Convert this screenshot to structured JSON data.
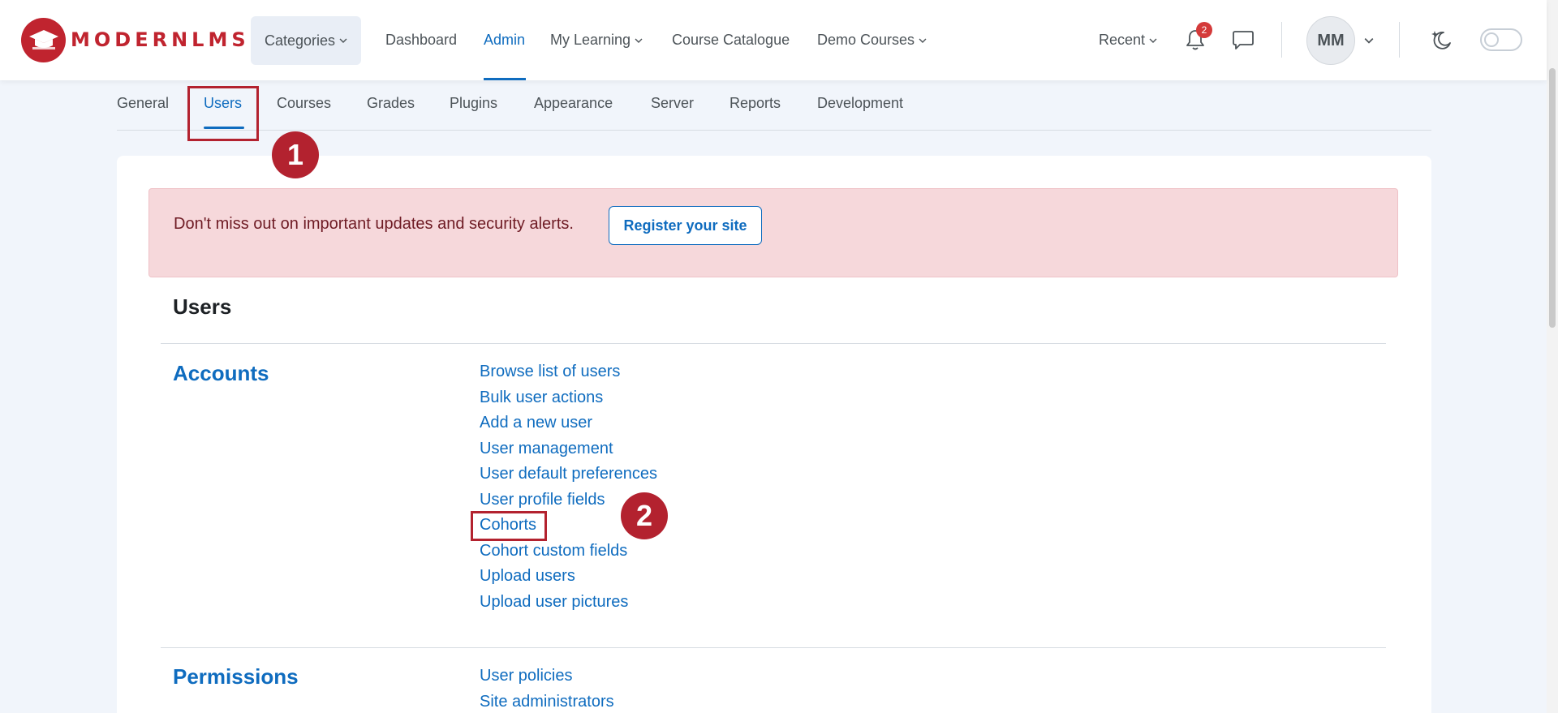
{
  "brand": {
    "logo_text": "MODERNLMS"
  },
  "navbar": {
    "categories": "Categories",
    "dashboard": "Dashboard",
    "admin": "Admin",
    "my_learning": "My Learning",
    "course_catalogue": "Course Catalogue",
    "demo_courses": "Demo Courses",
    "recent": "Recent",
    "notifications_count": "2",
    "avatar_initials": "MM"
  },
  "tabs": [
    "General",
    "Users",
    "Courses",
    "Grades",
    "Plugins",
    "Appearance",
    "Server",
    "Reports",
    "Development"
  ],
  "annotations": {
    "step1": "1",
    "step2": "2"
  },
  "alert": {
    "message": "Don't miss out on important updates and security alerts.",
    "button": "Register your site"
  },
  "page": {
    "title": "Users"
  },
  "sections": {
    "accounts": {
      "heading": "Accounts",
      "links": [
        "Browse list of users",
        "Bulk user actions",
        "Add a new user",
        "User management",
        "User default preferences",
        "User profile fields",
        "Cohorts",
        "Cohort custom fields",
        "Upload users",
        "Upload user pictures"
      ]
    },
    "permissions": {
      "heading": "Permissions",
      "links": [
        "User policies",
        "Site administrators"
      ]
    }
  },
  "colors": {
    "accent": "#0f6cbf",
    "brand": "#c0242f",
    "annotation": "#b3222f",
    "alert_bg": "#f6d8db"
  }
}
